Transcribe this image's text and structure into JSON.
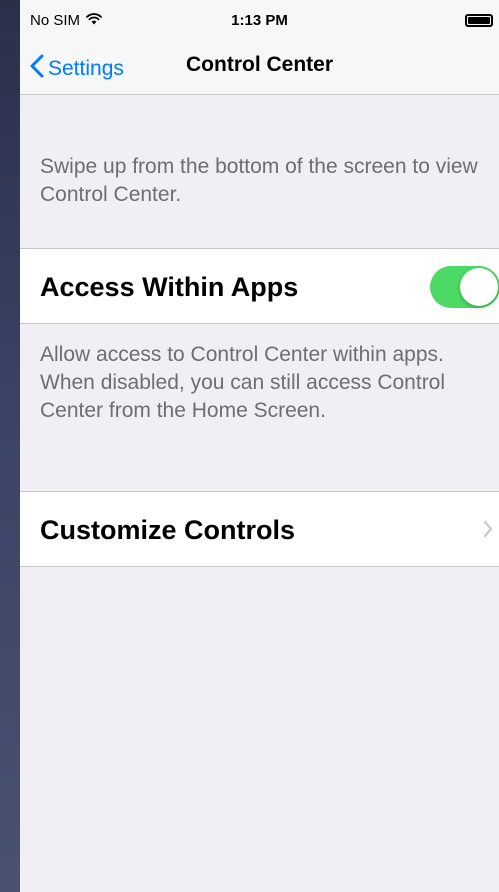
{
  "status_bar": {
    "carrier": "No SIM",
    "time": "1:13 PM",
    "wifi_icon": "wifi-icon",
    "battery_icon": "battery-icon"
  },
  "nav": {
    "back_label": "Settings",
    "back_icon": "chevron-left-icon",
    "title": "Control Center"
  },
  "intro_text": "Swipe up from the bottom of the screen to view Control Center.",
  "access_within_apps": {
    "label": "Access Within Apps",
    "enabled": true,
    "toggle_color": "#4cd964"
  },
  "access_description": "Allow access to Control Center within apps. When disabled, you can still access Control Center from the Home Screen.",
  "customize_controls": {
    "label": "Customize Controls",
    "chevron_icon": "chevron-right-icon"
  },
  "colors": {
    "accent": "#007aff",
    "background": "#efeff4",
    "secondary_text": "#6d6d72"
  }
}
